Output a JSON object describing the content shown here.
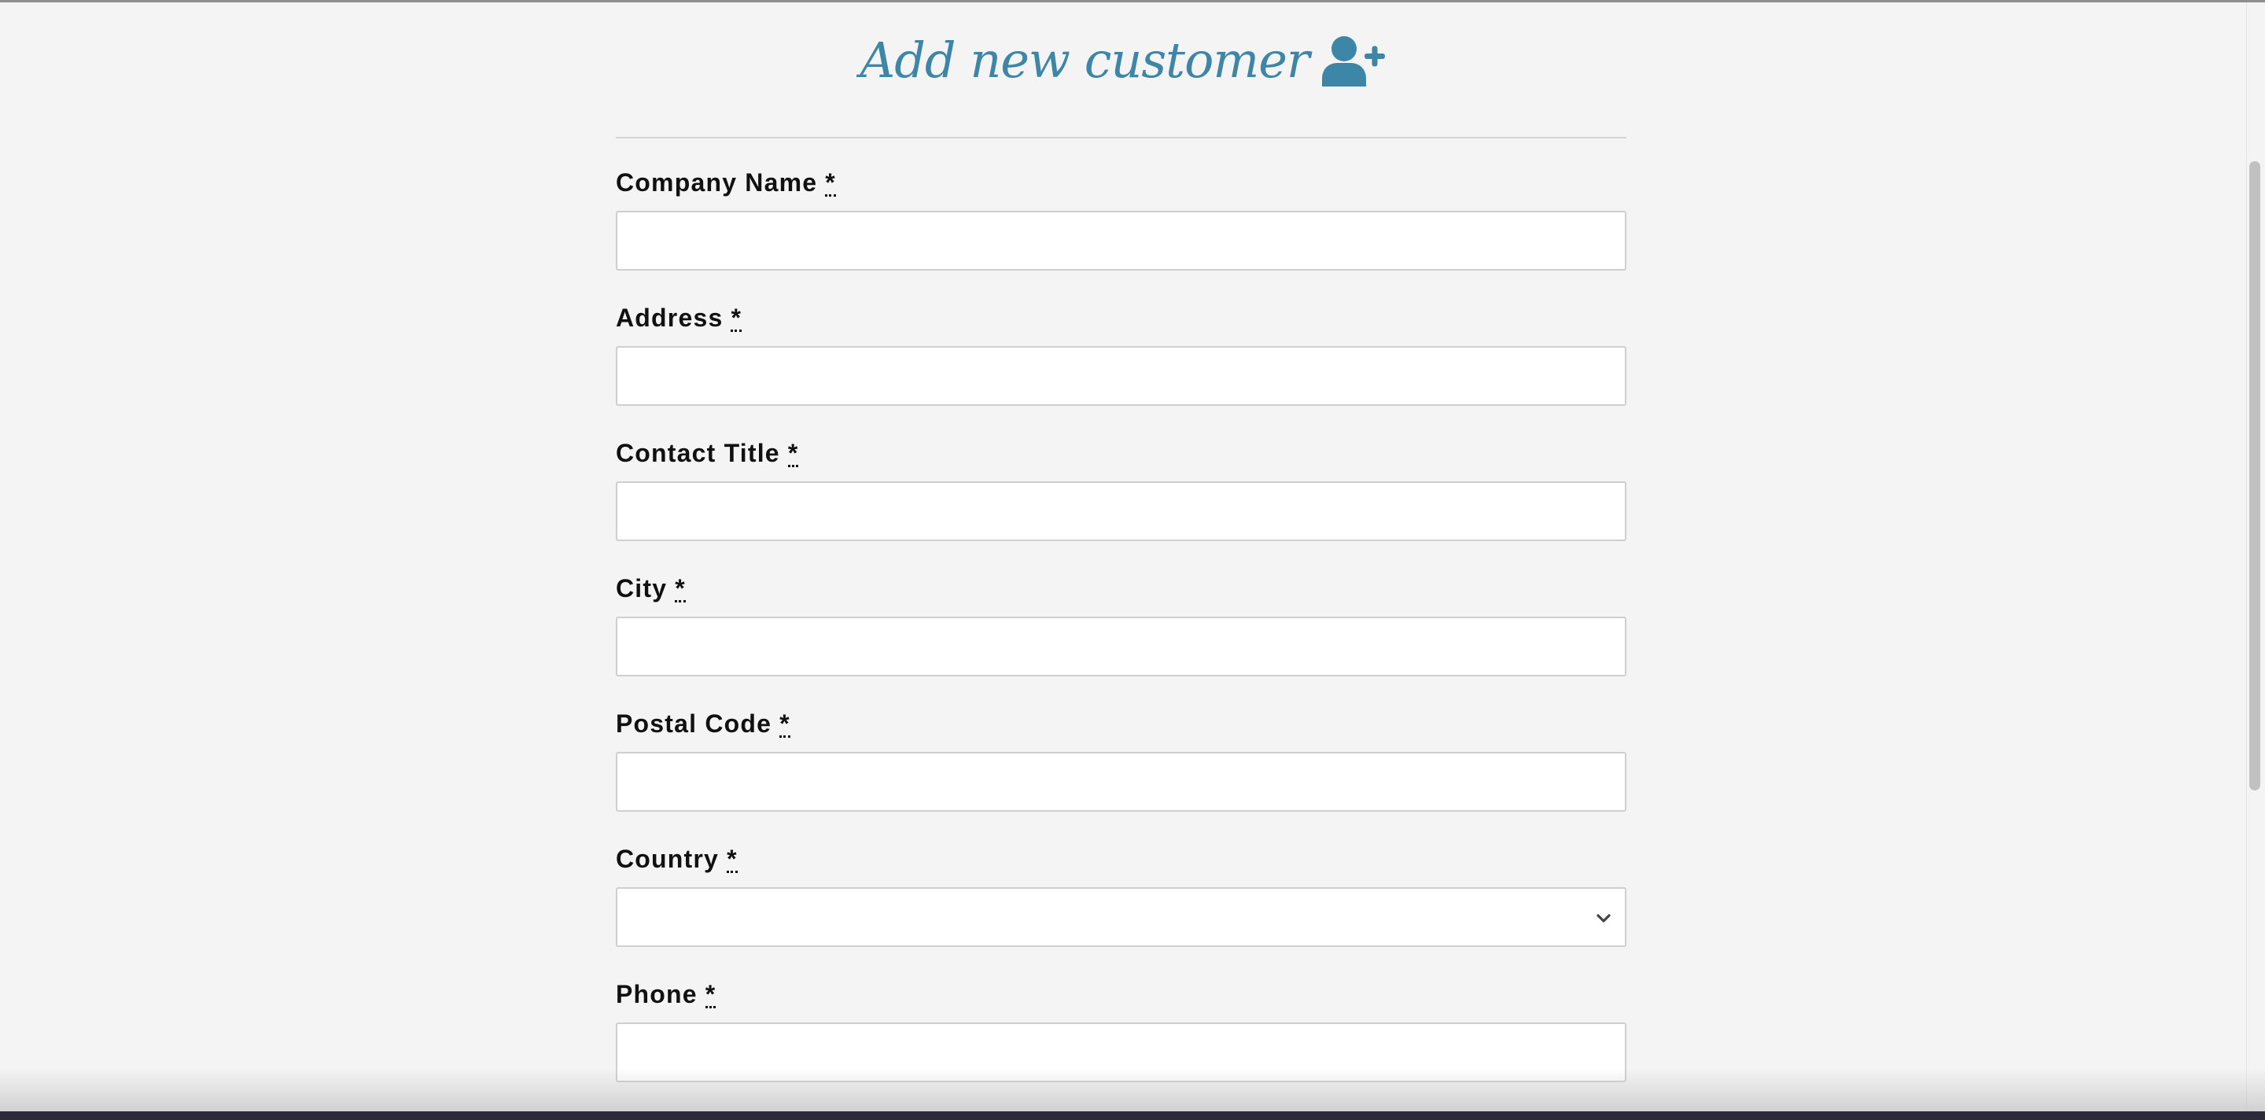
{
  "form": {
    "title": "Add new customer",
    "title_icon": "user-plus-icon",
    "accent_color": "#3d86a8",
    "required_marker": "*",
    "fields": [
      {
        "label": "Company Name",
        "type": "text",
        "value": "",
        "placeholder": ""
      },
      {
        "label": "Address",
        "type": "text",
        "value": "",
        "placeholder": ""
      },
      {
        "label": "Contact Title",
        "type": "text",
        "value": "",
        "placeholder": ""
      },
      {
        "label": "City",
        "type": "text",
        "value": "",
        "placeholder": ""
      },
      {
        "label": "Postal Code",
        "type": "text",
        "value": "",
        "placeholder": ""
      },
      {
        "label": "Country",
        "type": "select",
        "value": "",
        "icon": "chevron-down-icon"
      },
      {
        "label": "Phone",
        "type": "text",
        "value": "",
        "placeholder": ""
      }
    ]
  }
}
